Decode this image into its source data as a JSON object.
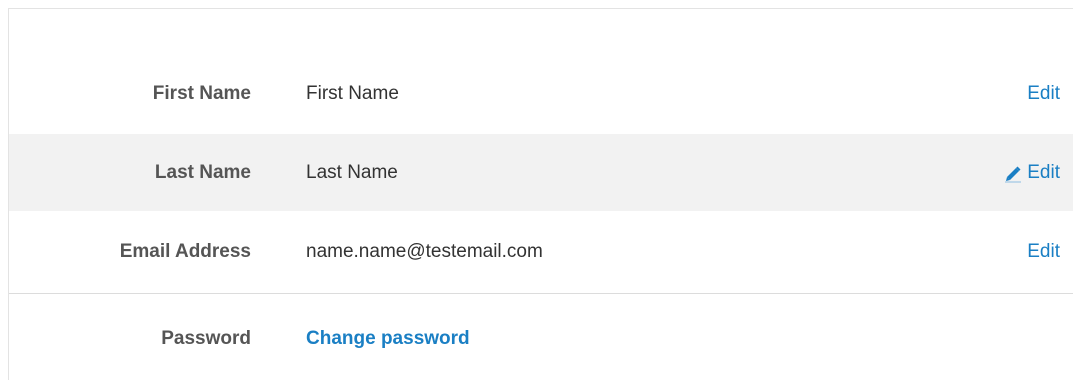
{
  "fields": [
    {
      "label": "First Name",
      "value": "First Name",
      "action": "Edit"
    },
    {
      "label": "Last Name",
      "value": "Last Name",
      "action": "Edit"
    },
    {
      "label": "Email Address",
      "value": "name.name@testemail.com",
      "action": "Edit"
    },
    {
      "label": "Password",
      "link": "Change password"
    }
  ],
  "colors": {
    "link": "#1a7fc4",
    "hover_row": "#f2f2f2",
    "label": "#555555",
    "value": "#333333"
  },
  "icons": {
    "edit_hover": "pencil-icon"
  }
}
